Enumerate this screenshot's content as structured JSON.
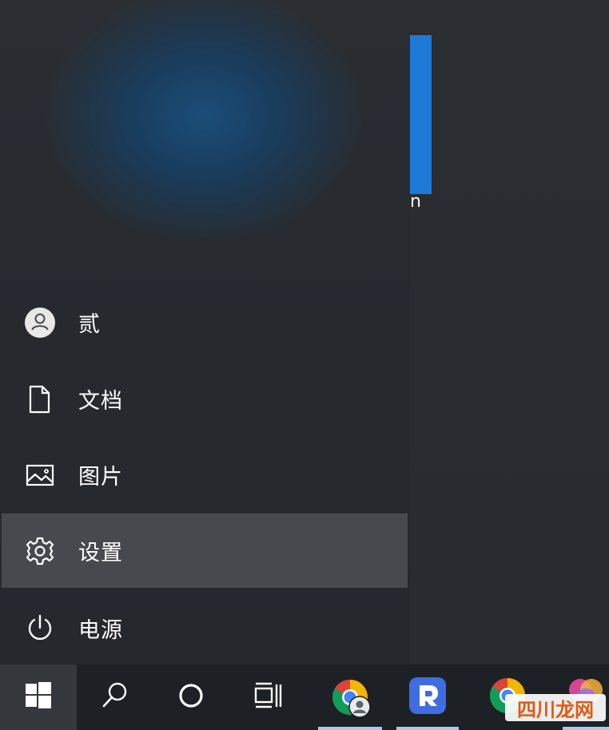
{
  "start_menu": {
    "items": [
      {
        "label": "贰",
        "icon": "user-avatar-icon"
      },
      {
        "label": "文档",
        "icon": "document-icon"
      },
      {
        "label": "图片",
        "icon": "picture-icon"
      },
      {
        "label": "设置",
        "icon": "gear-icon",
        "selected": true
      },
      {
        "label": "电源",
        "icon": "power-icon"
      }
    ]
  },
  "tile": {
    "glyph": "n",
    "color": "#1e7ad8"
  },
  "taskbar": {
    "items": [
      {
        "name": "start",
        "icon": "windows-logo-icon"
      },
      {
        "name": "search",
        "icon": "search-icon"
      },
      {
        "name": "cortana",
        "icon": "cortana-circle-icon"
      },
      {
        "name": "task-view",
        "icon": "task-view-icon"
      },
      {
        "name": "chrome-profile",
        "icon": "chrome-icon"
      },
      {
        "name": "app-r",
        "icon": "blue-r-app-icon"
      },
      {
        "name": "chrome",
        "icon": "chrome-icon"
      }
    ]
  },
  "watermark": {
    "text": "四川龙网"
  }
}
